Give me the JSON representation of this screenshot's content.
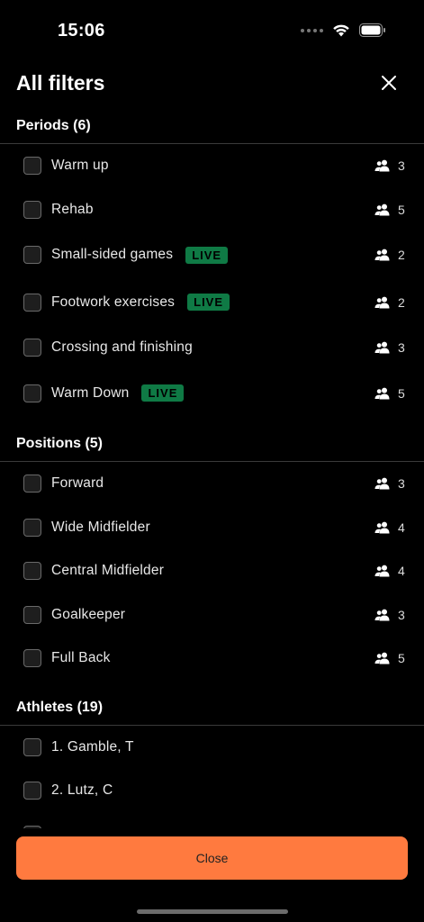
{
  "status": {
    "time": "15:06"
  },
  "header": {
    "title": "All filters",
    "close_icon": "close-icon"
  },
  "sections": [
    {
      "title": "Periods (6)",
      "items": [
        {
          "label": "Warm up",
          "live": false,
          "count": "3"
        },
        {
          "label": "Rehab",
          "live": false,
          "count": "5"
        },
        {
          "label": "Small-sided games",
          "live": true,
          "count": "2"
        },
        {
          "label": "Footwork exercises",
          "live": true,
          "count": "2"
        },
        {
          "label": "Crossing and finishing",
          "live": false,
          "count": "3"
        },
        {
          "label": "Warm Down",
          "live": true,
          "count": "5"
        }
      ]
    },
    {
      "title": "Positions (5)",
      "items": [
        {
          "label": "Forward",
          "count": "3"
        },
        {
          "label": "Wide Midfielder",
          "count": "4"
        },
        {
          "label": "Central Midfielder",
          "count": "4"
        },
        {
          "label": "Goalkeeper",
          "count": "3"
        },
        {
          "label": "Full Back",
          "count": "5"
        }
      ]
    },
    {
      "title": "Athletes (19)",
      "items": [
        {
          "label": "1. Gamble, T"
        },
        {
          "label": "2. Lutz, C"
        }
      ]
    }
  ],
  "live_label": "LIVE",
  "footer": {
    "close_label": "Close"
  },
  "colors": {
    "accent": "#ff7a3f",
    "live_bg": "#0f7a45",
    "background": "#000000"
  }
}
